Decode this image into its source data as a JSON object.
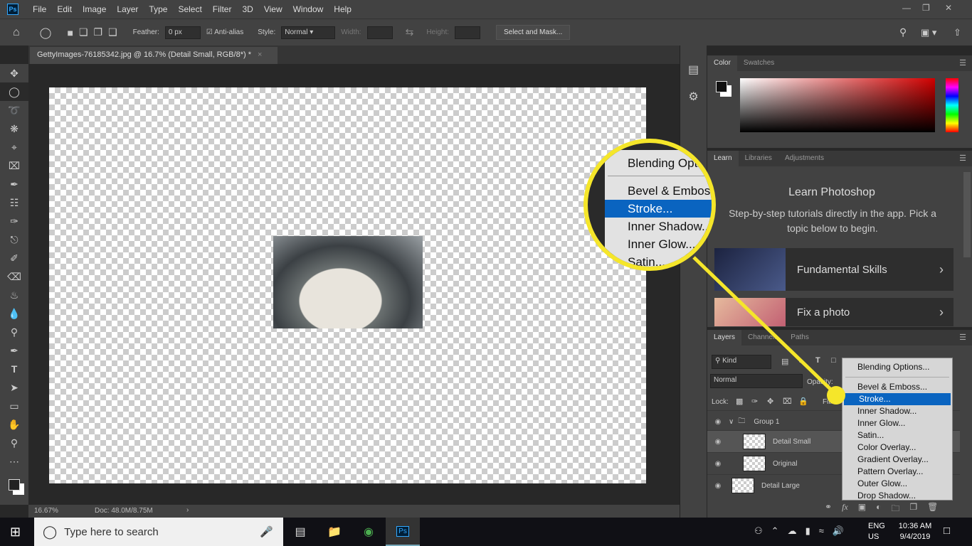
{
  "app": {
    "logo": "Ps",
    "menu": [
      "File",
      "Edit",
      "Image",
      "Layer",
      "Type",
      "Select",
      "Filter",
      "3D",
      "View",
      "Window",
      "Help"
    ]
  },
  "options": {
    "feather_label": "Feather:",
    "feather_value": "0 px",
    "antialias_label": "Anti-alias",
    "antialias_checked": true,
    "style_label": "Style:",
    "style_value": "Normal",
    "width_label": "Width:",
    "height_label": "Height:",
    "select_mask": "Select and Mask..."
  },
  "document": {
    "tab_title": "GettyImages-76185342.jpg @ 16.7% (Detail Small, RGB/8*) *",
    "zoom": "16.67%",
    "doc_info": "Doc: 48.0M/8.75M"
  },
  "color_panel": {
    "tabs": [
      "Color",
      "Swatches"
    ],
    "hue_color": "#d10000"
  },
  "learn_panel": {
    "tabs": [
      "Learn",
      "Libraries",
      "Adjustments"
    ],
    "title": "Learn Photoshop",
    "description": "Step-by-step tutorials directly in the app. Pick a topic below to begin.",
    "cards": [
      "Fundamental Skills",
      "Fix a photo"
    ]
  },
  "layers_panel": {
    "tabs": [
      "Layers",
      "Channels",
      "Paths"
    ],
    "filter": "Kind",
    "blend_mode": "Normal",
    "opacity_label": "Opacity:",
    "lock_label": "Lock:",
    "fill_label": "Fill:",
    "layers": [
      {
        "name": "Group 1",
        "type": "group"
      },
      {
        "name": "Detail Small",
        "selected": true
      },
      {
        "name": "Original"
      },
      {
        "name": "Detail Large"
      }
    ]
  },
  "fx_menu": {
    "items": [
      "Blending Options...",
      "Bevel & Emboss...",
      "Stroke...",
      "Inner Shadow...",
      "Inner Glow...",
      "Satin...",
      "Color Overlay...",
      "Gradient Overlay...",
      "Pattern Overlay...",
      "Outer Glow...",
      "Drop Shadow..."
    ],
    "selected": "Stroke..."
  },
  "magnifier": {
    "items": [
      "Blending Opti",
      "Bevel & Emboss",
      "Stroke...",
      "Inner Shadow...",
      "Inner Glow...",
      "Satin..."
    ],
    "highlight_color": "#f5e62a"
  },
  "taskbar": {
    "search_placeholder": "Type here to search",
    "lang": "ENG",
    "region": "US",
    "time": "10:36 AM",
    "date": "9/4/2019"
  }
}
